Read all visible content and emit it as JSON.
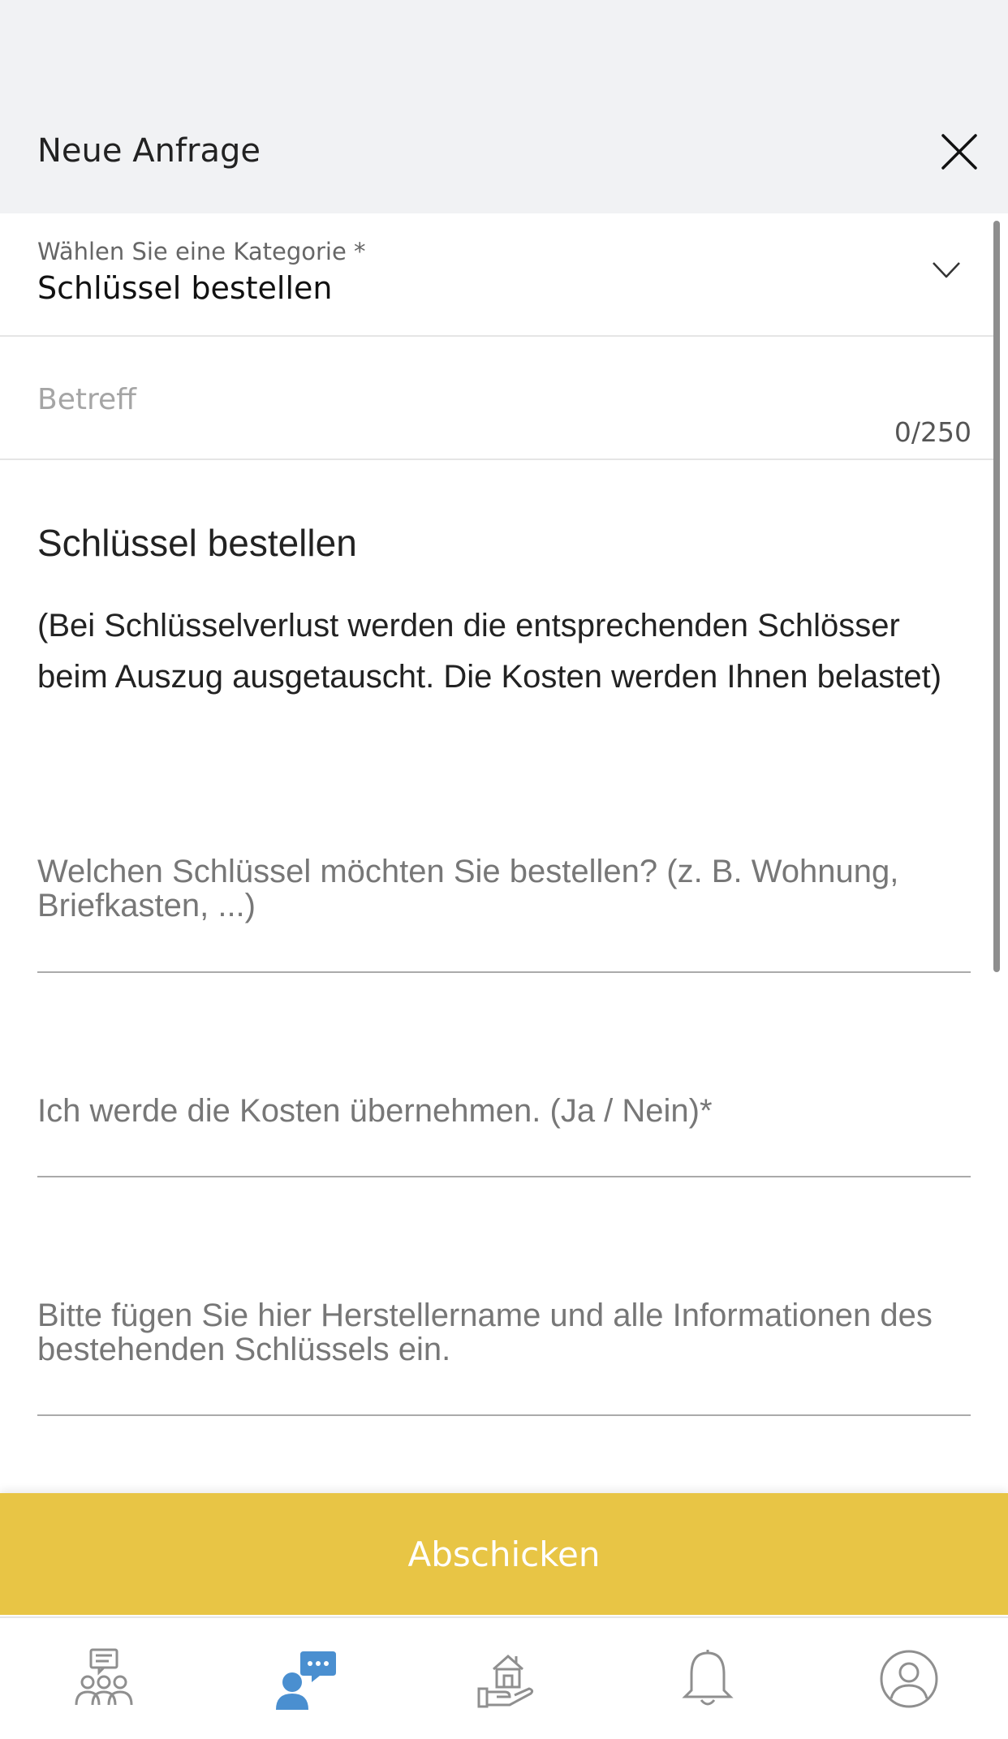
{
  "header": {
    "title": "Neue Anfrage"
  },
  "category": {
    "label": "Wählen Sie eine Kategorie *",
    "value": "Schlüssel bestellen"
  },
  "subject": {
    "placeholder": "Betreff",
    "value": "",
    "char_count": "0/250"
  },
  "section": {
    "title": "Schlüssel bestellen",
    "description": "(Bei Schlüsselverlust werden die entsprechenden Schlösser beim Auszug ausgetauscht. Die Kosten werden Ihnen belastet)"
  },
  "fields": [
    {
      "placeholder": "Welchen Schlüssel möchten Sie bestellen? (z. B. Wohnung, Briefkasten, ...)"
    },
    {
      "placeholder": "Ich werde die Kosten übernehmen. (Ja / Nein)*"
    },
    {
      "placeholder": "Bitte fügen Sie hier Herstellername und alle Informationen des bestehenden Schlüssels ein."
    }
  ],
  "submit": {
    "label": "Abschicken"
  },
  "nav": {
    "active_index": 1,
    "active_color": "#4a8fd0",
    "inactive_color": "#8f8f8f",
    "items": [
      {
        "icon": "community-icon"
      },
      {
        "icon": "chat-request-icon"
      },
      {
        "icon": "house-hand-icon"
      },
      {
        "icon": "bell-icon"
      },
      {
        "icon": "profile-icon"
      }
    ]
  },
  "colors": {
    "accent": "#e8c545",
    "header_bg": "#f1f2f4"
  }
}
